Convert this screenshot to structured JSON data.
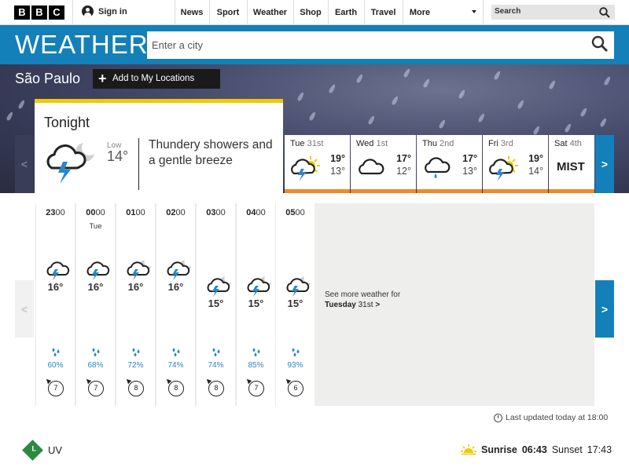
{
  "topbar": {
    "logo_letters": [
      "B",
      "B",
      "C"
    ],
    "signin_label": "Sign in",
    "nav": [
      "News",
      "Sport",
      "Weather",
      "Shop",
      "Earth",
      "Travel",
      "More"
    ],
    "search_placeholder": "Search"
  },
  "weather_header": {
    "logo": "WEATHER",
    "city_placeholder": "Enter a city"
  },
  "location": {
    "name": "São Paulo",
    "add_label": "Add to My Locations"
  },
  "tonight": {
    "title": "Tonight",
    "low_label": "Low",
    "low_value": "14°",
    "description": "Thundery showers and a gentle breeze"
  },
  "days": [
    {
      "name": "Tue",
      "num": "31st",
      "icon": "thunder-sun-icon",
      "hi": "19°",
      "lo": "13°"
    },
    {
      "name": "Wed",
      "num": "1st",
      "icon": "cloud-icon",
      "hi": "17°",
      "lo": "12°"
    },
    {
      "name": "Thu",
      "num": "2nd",
      "icon": "light-rain-icon",
      "hi": "17°",
      "lo": "13°"
    },
    {
      "name": "Fri",
      "num": "3rd",
      "icon": "thunder-sun-icon",
      "hi": "19°",
      "lo": "14°"
    },
    {
      "name": "Sat",
      "num": "4th",
      "icon": "mist",
      "text": "MIST"
    }
  ],
  "hours": [
    {
      "hour": "23",
      "min": "00",
      "day": "",
      "icon": "thunder-cloud-icon",
      "temp": "16°",
      "rain": "60%",
      "wind": "7"
    },
    {
      "hour": "00",
      "min": "00",
      "day": "Tue",
      "icon": "thunder-cloud-icon",
      "temp": "16°",
      "rain": "68%",
      "wind": "7"
    },
    {
      "hour": "01",
      "min": "00",
      "day": "",
      "icon": "thunder-moon-icon",
      "temp": "16°",
      "rain": "72%",
      "wind": "8"
    },
    {
      "hour": "02",
      "min": "00",
      "day": "",
      "icon": "thunder-moon-icon",
      "temp": "16°",
      "rain": "74%",
      "wind": "8"
    },
    {
      "hour": "03",
      "min": "00",
      "day": "",
      "icon": "thunder-moon-icon",
      "temp": "15°",
      "rain": "74%",
      "wind": "8"
    },
    {
      "hour": "04",
      "min": "00",
      "day": "",
      "icon": "thunder-moon-icon",
      "temp": "15°",
      "rain": "85%",
      "wind": "7"
    },
    {
      "hour": "05",
      "min": "00",
      "day": "",
      "icon": "thunder-moon-icon",
      "temp": "15°",
      "rain": "93%",
      "wind": "6"
    }
  ],
  "see_more": {
    "line1": "See more weather for",
    "day": "Tuesday",
    "date": "31st",
    "arrow": ">"
  },
  "arrows": {
    "prev": "<",
    "next": ">"
  },
  "updated": "Last updated today at 18:00",
  "uv": {
    "badge": "L",
    "label": "UV",
    "color": "#2b8a3e"
  },
  "sun": {
    "sunrise_label": "Sunrise",
    "sunrise": "06:43",
    "sunset_label": "Sunset",
    "sunset": "17:43"
  },
  "colors": {
    "brand_blue": "#1380b9",
    "tonight_accent": "#f2c800",
    "day_accent": "#f0892b",
    "rain_blue": "#2a87c8"
  }
}
